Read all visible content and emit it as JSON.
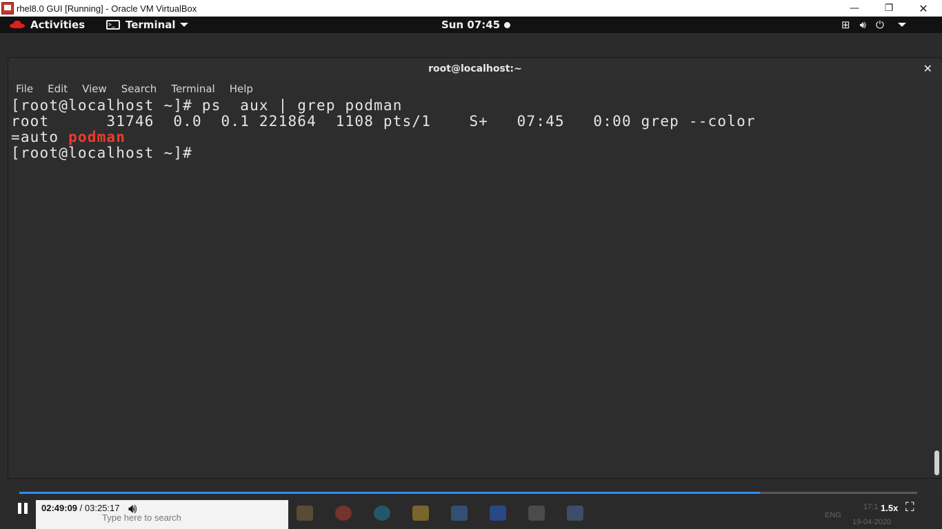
{
  "host_window": {
    "title": "rhel8.0 GUI [Running] - Oracle VM VirtualBox",
    "minimize": "—",
    "restore": "❐",
    "close": "✕"
  },
  "gnome_bar": {
    "activities": "Activities",
    "app_menu": "Terminal",
    "clock": "Sun 07:45",
    "tray_icons": [
      "network-icon",
      "volume-icon",
      "power-icon",
      "chevron-down-icon"
    ]
  },
  "terminal": {
    "title": "root@localhost:~",
    "close": "✕",
    "menu": [
      "File",
      "Edit",
      "View",
      "Search",
      "Terminal",
      "Help"
    ],
    "lines": {
      "l1": "[root@localhost ~]# ps  aux | grep podman",
      "l2": "root      31746  0.0  0.1 221864  1108 pts/1    S+   07:45   0:00 grep --color",
      "l3_prefix": "=auto ",
      "l3_match": "podman",
      "l4": "[root@localhost ~]#"
    }
  },
  "player": {
    "current_time": "02:49:09",
    "separator": " / ",
    "total_time": "03:25:17",
    "progress_fraction": 0.825,
    "speed": "1.5x",
    "search_placeholder": "Type here to search",
    "lang": "ENG",
    "date": "19-04-2020",
    "clock_partial": "17:1"
  },
  "colors": {
    "accent": "#2f8ff0",
    "match": "#ef3b2c"
  }
}
